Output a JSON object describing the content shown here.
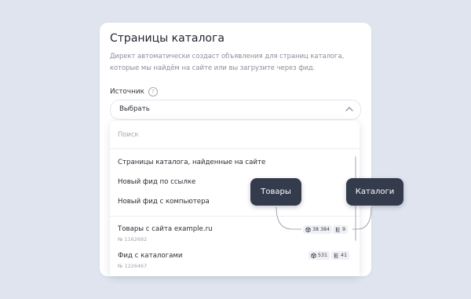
{
  "card": {
    "title": "Страницы каталога",
    "description": "Директ автоматически создаст объявления для страниц каталога, которые мы найдём на сайте или вы загрузите через фид.",
    "source_label": "Источник",
    "help_icon": "question-circle-icon",
    "select_value": "Выбрать",
    "chevron_icon": "chevron-up-icon"
  },
  "dropdown": {
    "search_placeholder": "Поиск",
    "options": [
      "Страницы каталога, найденные на сайте",
      "Новый фид по ссылке",
      "Новый фид с компьютера"
    ],
    "feeds": [
      {
        "name": "Товары с сайта example.ru",
        "id": "№ 1162692",
        "products": "38 384",
        "catalogs": "9"
      },
      {
        "name": "Фид с каталогами",
        "id": "№ 1226467",
        "products": "531",
        "catalogs": "41"
      }
    ]
  },
  "tooltips": {
    "products": "Товары",
    "catalogs": "Каталоги"
  },
  "colors": {
    "background": "#dfe4ee",
    "tooltip": "#343b4d",
    "badge": "#eef0f4"
  }
}
